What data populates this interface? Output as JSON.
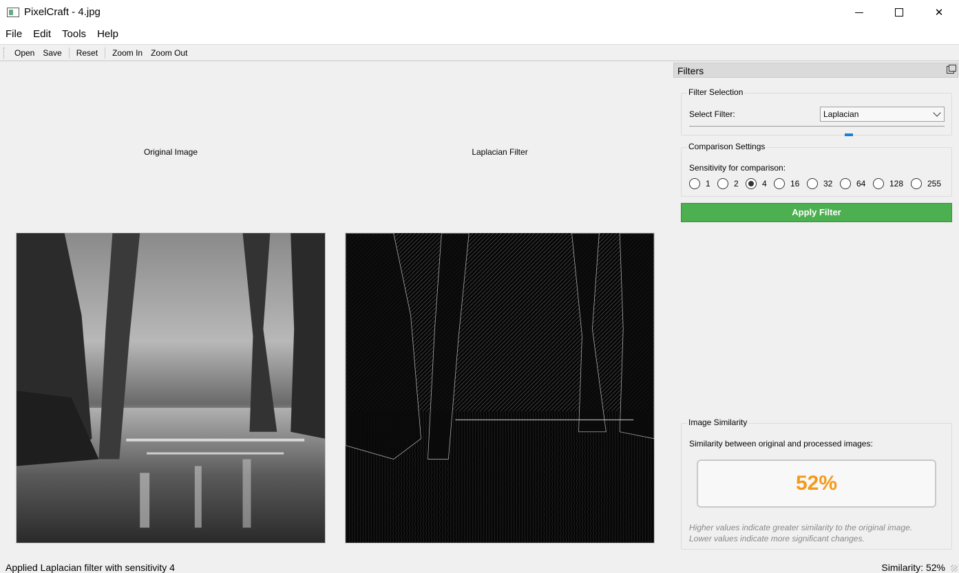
{
  "window": {
    "title": "PixelCraft - 4.jpg",
    "minimize_icon": "minimize-icon",
    "maximize_icon": "maximize-icon",
    "close_icon": "close-icon"
  },
  "menu": {
    "items": [
      "File",
      "Edit",
      "Tools",
      "Help"
    ]
  },
  "toolbar": {
    "open": "Open",
    "save": "Save",
    "reset": "Reset",
    "zoom_in": "Zoom In",
    "zoom_out": "Zoom Out"
  },
  "images": {
    "original_label": "Original Image",
    "filtered_label": "Laplacian Filter"
  },
  "dock": {
    "title": "Filters",
    "filter_group": {
      "title": "Filter Selection",
      "select_label": "Select Filter:",
      "selected": "Laplacian"
    },
    "comparison_group": {
      "title": "Comparison Settings",
      "sensitivity_label": "Sensitivity for comparison:",
      "options": [
        "1",
        "2",
        "4",
        "16",
        "32",
        "64",
        "128",
        "255"
      ],
      "selected": "4"
    },
    "apply_button": "Apply Filter",
    "similarity_group": {
      "title": "Image Similarity",
      "description": "Similarity between original and processed images:",
      "value": "52%",
      "note_line1": "Higher values indicate greater similarity to the original image.",
      "note_line2": "Lower values indicate more significant changes."
    }
  },
  "status": {
    "message": "Applied Laplacian filter with sensitivity 4",
    "similarity": "Similarity: 52%"
  },
  "colors": {
    "apply_button": "#4caf50",
    "similarity_value": "#f39a1a",
    "slider_handle": "#1a7fd6"
  }
}
